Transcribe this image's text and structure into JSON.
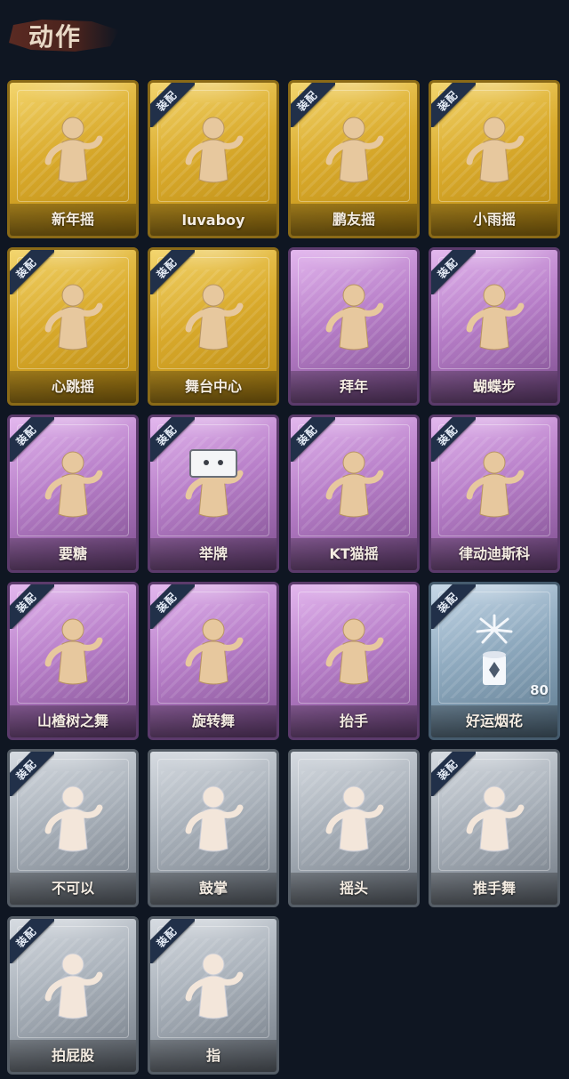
{
  "header": {
    "title": "动作"
  },
  "badge_label": "装配",
  "items": [
    {
      "name": "新年摇",
      "rarity": "gold",
      "equipped": false,
      "icon": "wave-hands-icon"
    },
    {
      "name": "luvaboy",
      "rarity": "gold",
      "equipped": true,
      "icon": "dance-pose-icon"
    },
    {
      "name": "鹏友摇",
      "rarity": "gold",
      "equipped": true,
      "icon": "point-dance-icon"
    },
    {
      "name": "小雨摇",
      "rarity": "gold",
      "equipped": true,
      "icon": "music-dance-icon"
    },
    {
      "name": "心跳摇",
      "rarity": "gold",
      "equipped": true,
      "icon": "heartbeat-dance-icon"
    },
    {
      "name": "舞台中心",
      "rarity": "gold",
      "equipped": true,
      "icon": "stage-center-icon"
    },
    {
      "name": "拜年",
      "rarity": "purple",
      "equipped": false,
      "icon": "greeting-bow-icon"
    },
    {
      "name": "蝴蝶步",
      "rarity": "purple",
      "equipped": true,
      "icon": "butterfly-step-icon"
    },
    {
      "name": "要糖",
      "rarity": "purple",
      "equipped": true,
      "icon": "ask-candy-icon"
    },
    {
      "name": "举牌",
      "rarity": "purple",
      "equipped": true,
      "icon": "hold-sign-icon"
    },
    {
      "name": "KT猫摇",
      "rarity": "purple",
      "equipped": true,
      "icon": "cat-dance-icon"
    },
    {
      "name": "律动迪斯科",
      "rarity": "purple",
      "equipped": true,
      "icon": "disco-icon"
    },
    {
      "name": "山楂树之舞",
      "rarity": "purple",
      "equipped": true,
      "icon": "hawthorn-dance-icon"
    },
    {
      "name": "旋转舞",
      "rarity": "purple",
      "equipped": true,
      "icon": "spin-dance-icon"
    },
    {
      "name": "抬手",
      "rarity": "purple",
      "equipped": false,
      "icon": "raise-hand-icon"
    },
    {
      "name": "好运烟花",
      "rarity": "blue",
      "equipped": true,
      "icon": "firework-icon",
      "count": "80"
    },
    {
      "name": "不可以",
      "rarity": "gray",
      "equipped": true,
      "icon": "finger-no-icon"
    },
    {
      "name": "鼓掌",
      "rarity": "gray",
      "equipped": false,
      "icon": "clap-icon"
    },
    {
      "name": "摇头",
      "rarity": "gray",
      "equipped": false,
      "icon": "shake-head-icon"
    },
    {
      "name": "推手舞",
      "rarity": "gray",
      "equipped": true,
      "icon": "push-hand-dance-icon"
    },
    {
      "name": "拍屁股",
      "rarity": "gray",
      "equipped": true,
      "icon": "butt-slap-icon"
    },
    {
      "name": "指",
      "rarity": "gray",
      "equipped": true,
      "icon": "point-finger-icon"
    }
  ],
  "colors": {
    "gold": "#d9aa2c",
    "purple": "#b77ec8",
    "blue": "#8ea9be",
    "gray": "#a8b0b9",
    "background": "#0f1622"
  }
}
